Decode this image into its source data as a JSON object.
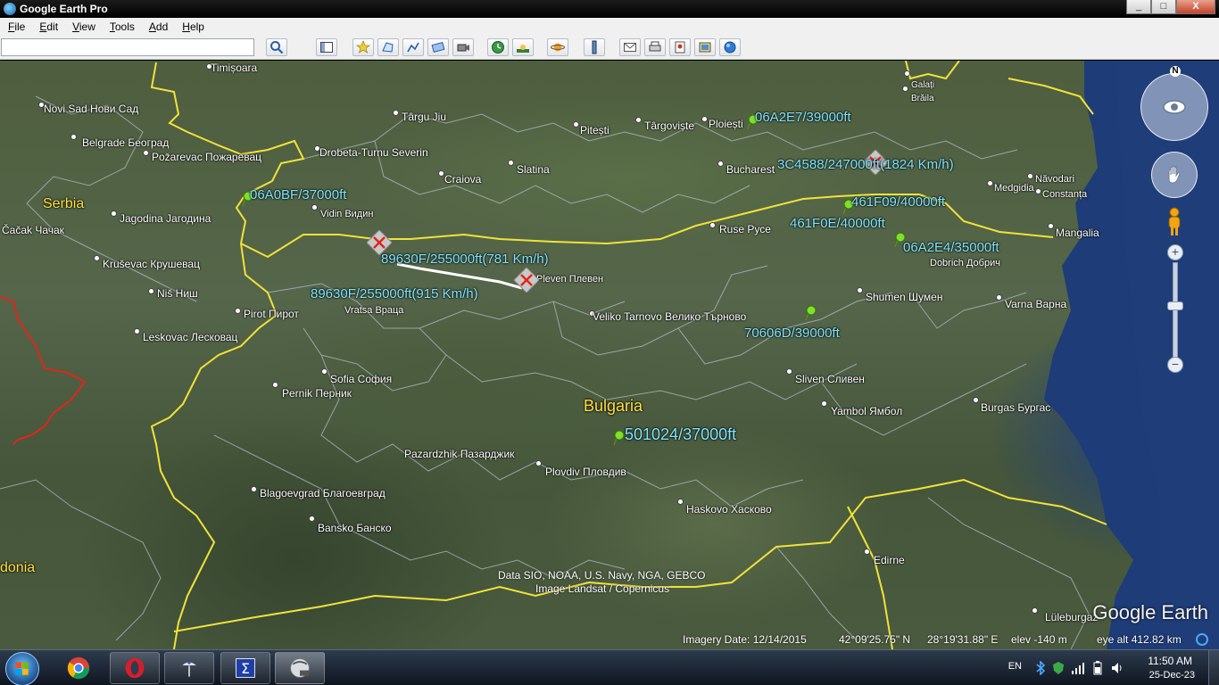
{
  "window": {
    "title": "Google Earth Pro",
    "controls": [
      "_",
      "□",
      "X"
    ]
  },
  "menu": [
    "File",
    "Edit",
    "View",
    "Tools",
    "Add",
    "Help"
  ],
  "search": {
    "value": "",
    "placeholder": ""
  },
  "toolbar_icons": [
    "search-icon",
    "sidebar-icon",
    "placemark-icon",
    "polygon-icon",
    "path-icon",
    "image-overlay-icon",
    "record-tour-icon",
    "historical-imagery-icon",
    "sunlight-icon",
    "planets-icon",
    "ruler-icon",
    "email-icon",
    "print-icon",
    "save-image-icon",
    "view-in-maps-icon",
    "earth-gallery-icon"
  ],
  "countries": [
    "Serbia",
    "Bulgaria",
    "donia"
  ],
  "places": [
    "Timișoara",
    "Novi Sad Нови Сад",
    "Belgrade Београд",
    "Požarevac Пожаревац",
    "Čačak Чачак",
    "Jagodina Јагодина",
    "Kruševac Крушевац",
    "Niš Ниш",
    "Pirot Пирот",
    "Leskovac Лесковац",
    "Târgu Jiu",
    "Drobeta-Turnu Severin",
    "Craiova",
    "Slatina",
    "Pitești",
    "Târgoviște",
    "Ploiești",
    "Bucharest",
    "Galați",
    "Brăila",
    "Năvodari",
    "Constanța",
    "Medgidia",
    "Mangalia",
    "Vidin Видин",
    "Ruse Русе",
    "Pleven Плевен",
    "Vratsa Враца",
    "Veliko Tarnovo Велико Търново",
    "Dobrich Добрич",
    "Shumen Шумен",
    "Varna Варна",
    "Sofia София",
    "Pernik Перник",
    "Sliven Сливен",
    "Yambol Ямбол",
    "Burgas Бургас",
    "Pazardzhik Пазарджик",
    "Plovdiv Пловдив",
    "Blagoevgrad Благоевград",
    "Haskovo Хасково",
    "Bansko Банско",
    "Edirne",
    "Lüleburgaz"
  ],
  "flights": [
    "06A2E7/39000ft",
    "3C4588/247000ft(1824 Km/h)",
    "06A0BF/37000ft",
    "461F09/40000ft",
    "461F0E/40000ft",
    "06A2E4/35000ft",
    "89630F/255000ft(781 Km/h)",
    "89630F/255000ft(915 Km/h)",
    "70606D/39000ft",
    "501024/37000ft"
  ],
  "attribution": [
    "Data SIO, NOAA, U.S. Navy, NGA, GEBCO",
    "Image Landsat / Copernicus"
  ],
  "brand": "Google Earth",
  "status": {
    "imagery_date": "Imagery Date: 12/14/2015",
    "lat": "42°09'25.75\" N",
    "lon": "28°19'31.88\" E",
    "elev": "elev  -140 m",
    "eye_alt": "eye alt 412.82 km"
  },
  "compass_north": "N",
  "tray": {
    "lang": "EN",
    "time": "11:50 AM",
    "date": "25-Dec-23"
  },
  "colors": {
    "border_yellow": "#f1e23a",
    "border_red": "#e0261b",
    "flight_label": "#7fe6ff",
    "sea": "#1f3f7f"
  }
}
